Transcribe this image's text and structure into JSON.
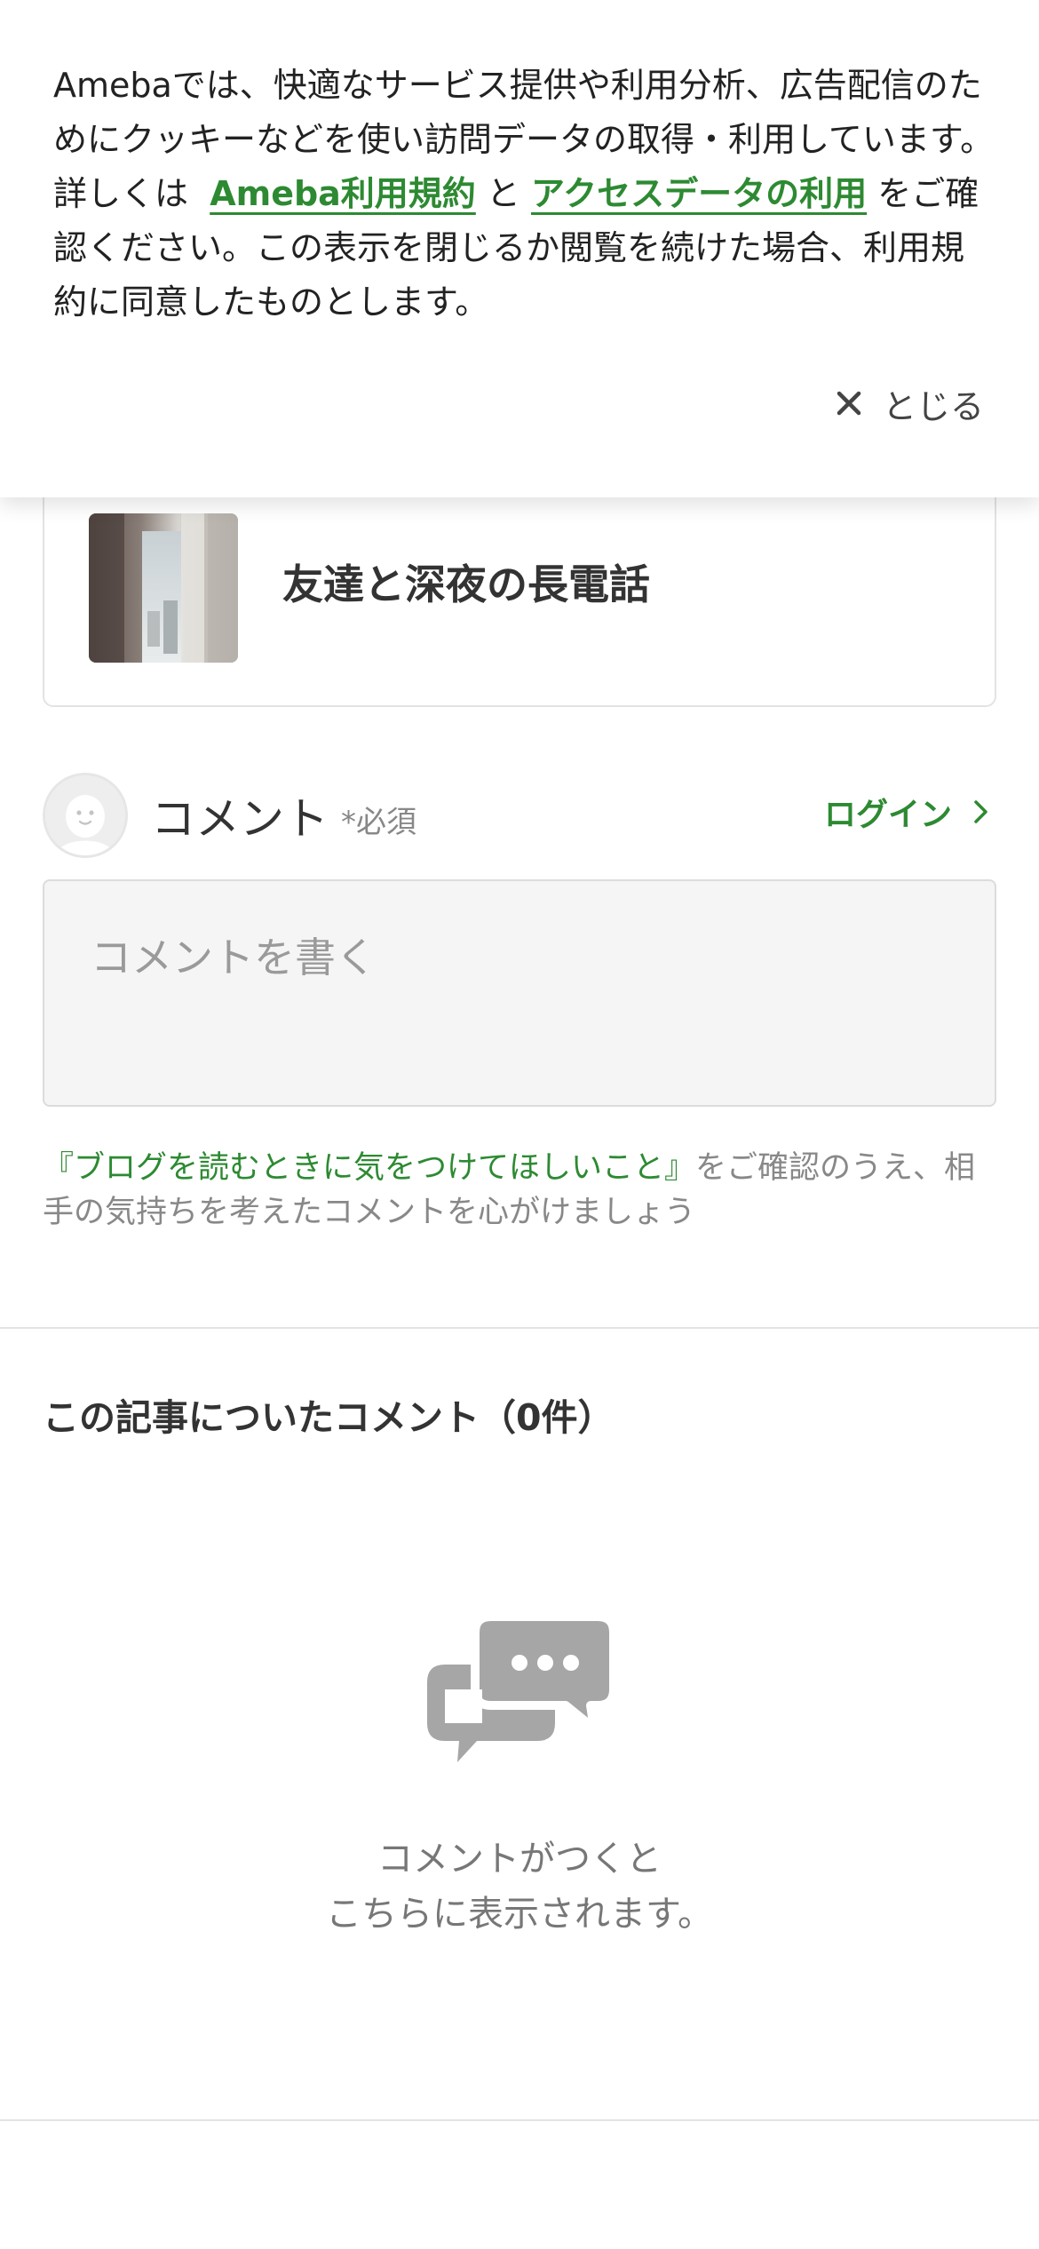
{
  "cookie_banner": {
    "text_before": "Amebaでは、快適なサービス提供や利用分析、広告配信のためにクッキーなどを使い訪問データの取得・利用しています。詳しくは",
    "terms_link": "Ameba利用規約",
    "connector": "と",
    "access_data_link": "アクセスデータの利用",
    "text_after": "をご確認ください。この表示を閉じるか閲覧を続けた場合、利用規約に同意したものとします。",
    "close_label": "とじる"
  },
  "article_card": {
    "title": "友達と深夜の長電話"
  },
  "comment_form": {
    "label": "コメント",
    "required": "*必須",
    "login_label": "ログイン",
    "placeholder": "コメントを書く",
    "guideline_link": "『ブログを読むときに気をつけてほしいこと』",
    "guideline_text": "をご確認のうえ、相手の気持ちを考えたコメントを心がけましょう"
  },
  "comments": {
    "heading": "この記事についたコメント（0件）",
    "empty_line1": "コメントがつくと",
    "empty_line2": "こちらに表示されます。"
  },
  "colors": {
    "accent_green": "#2d8a32",
    "icon_gray": "#a6a6a6",
    "text_dark": "#333333",
    "text_muted": "#888888"
  }
}
